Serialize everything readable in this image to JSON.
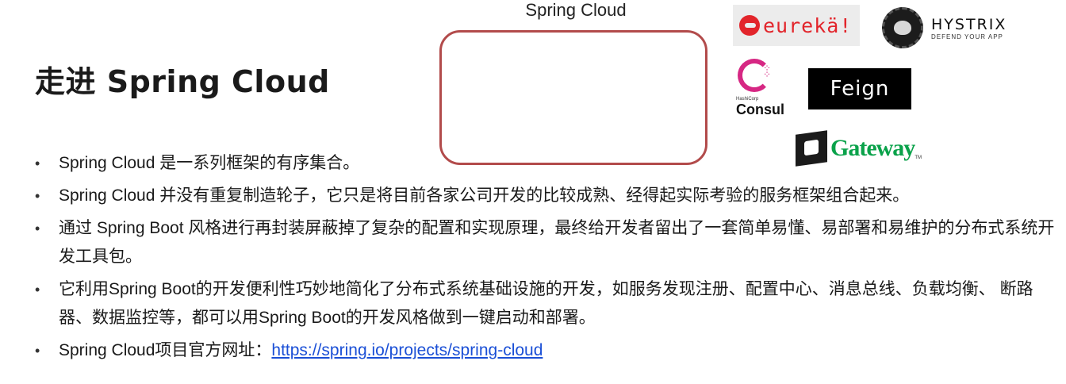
{
  "title": "走进 Spring Cloud",
  "diagram": {
    "label": "Spring Cloud"
  },
  "logos": {
    "eureka": "eurekä!",
    "hystrix_name": "HYSTRIX",
    "hystrix_tagline": "DEFEND YOUR APP",
    "consul_small": "HashiCorp",
    "consul": "Consul",
    "feign": "Feign",
    "gateway": "Gateway",
    "gateway_tm": "TM"
  },
  "bullets": [
    {
      "text": "Spring Cloud 是一系列框架的有序集合。"
    },
    {
      "text": "Spring Cloud 并没有重复制造轮子，它只是将目前各家公司开发的比较成熟、经得起实际考验的服务框架组合起来。"
    },
    {
      "text": "通过 Spring Boot 风格进行再封装屏蔽掉了复杂的配置和实现原理，最终给开发者留出了一套简单易懂、易部署和易维护的分布式系统开发工具包。"
    },
    {
      "text": "它利用Spring Boot的开发便利性巧妙地简化了分布式系统基础设施的开发，如服务发现注册、配置中心、消息总线、负载均衡、 断路器、数据监控等，都可以用Spring Boot的开发风格做到一键启动和部署。"
    },
    {
      "text": "Spring Cloud项目官方网址：",
      "link": "https://spring.io/projects/spring-cloud"
    }
  ],
  "bullet_symbol": "•"
}
